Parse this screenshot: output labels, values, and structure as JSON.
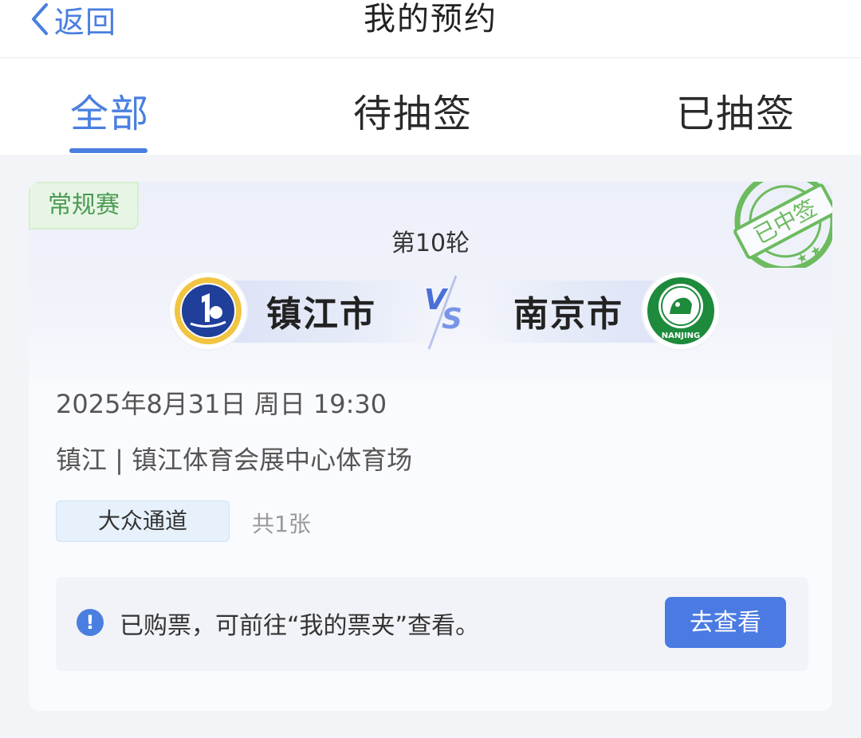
{
  "header": {
    "back_label": "返回",
    "title": "我的预约"
  },
  "tabs": [
    {
      "label": "全部",
      "active": true
    },
    {
      "label": "待抽签",
      "active": false
    },
    {
      "label": "已抽签",
      "active": false
    }
  ],
  "card": {
    "type_tag": "常规赛",
    "stamp_text": "已中签",
    "round": "第10轮",
    "home_team": "镇江市",
    "away_team": "南京市",
    "away_logo_text": "NANJING",
    "datetime": "2025年8月31日 周日 19:30",
    "venue": "镇江 | 镇江体育会展中心体育场",
    "channel": "大众通道",
    "ticket_count": "共1张",
    "notice": {
      "icon": "!",
      "text": "已购票，可前往“我的票夹”查看。",
      "button_label": "去查看"
    }
  },
  "colors": {
    "accent": "#4a7fe0",
    "stamp_green": "#6dbb5f",
    "tag_green": "#4a9a54"
  }
}
